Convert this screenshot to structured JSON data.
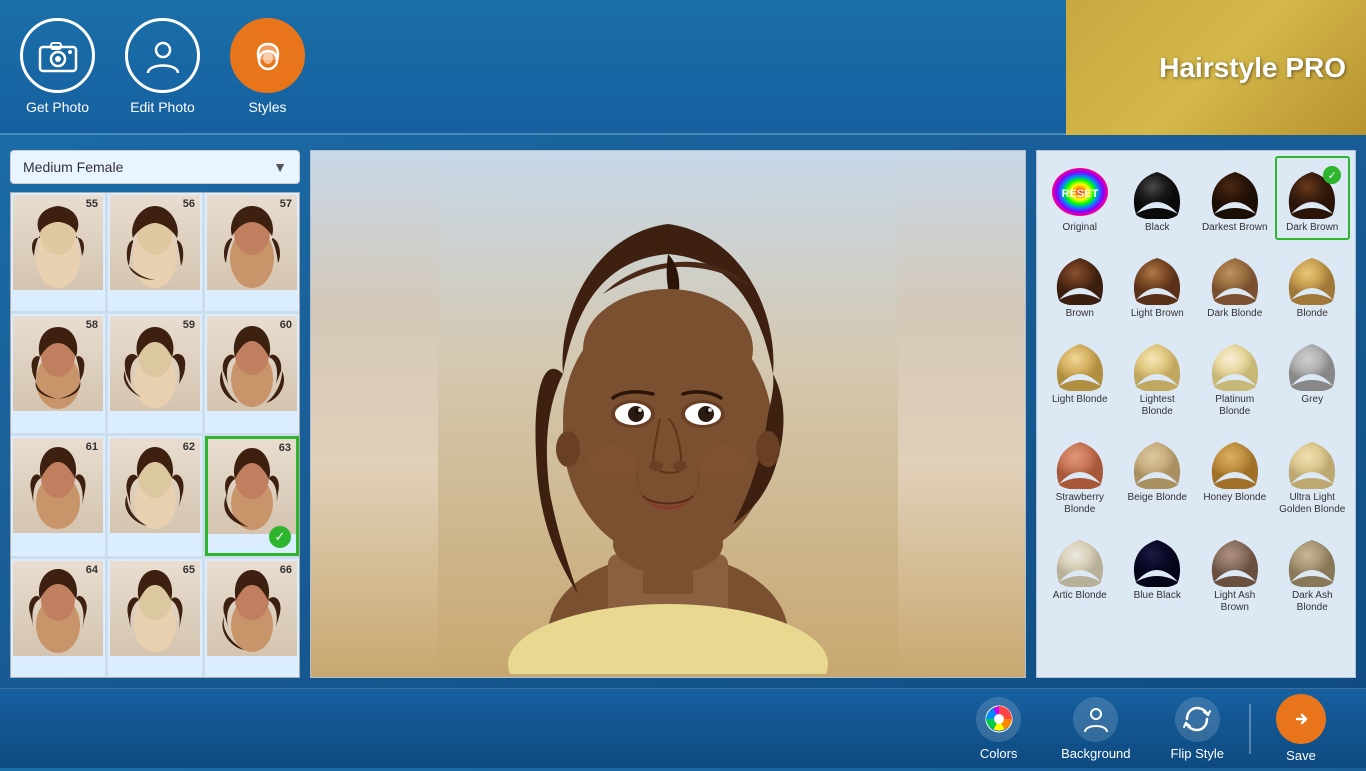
{
  "app": {
    "title": "Hairstyle PRO"
  },
  "nav": {
    "items": [
      {
        "id": "get-photo",
        "label": "Get Photo",
        "icon": "📷",
        "active": false
      },
      {
        "id": "edit-photo",
        "label": "Edit Photo",
        "icon": "👤",
        "active": false
      },
      {
        "id": "styles",
        "label": "Styles",
        "icon": "💇",
        "active": true
      }
    ]
  },
  "style_panel": {
    "dropdown_label": "Medium Female",
    "styles": [
      {
        "number": "55",
        "selected": false
      },
      {
        "number": "56",
        "selected": false
      },
      {
        "number": "57",
        "selected": false
      },
      {
        "number": "58",
        "selected": false
      },
      {
        "number": "59",
        "selected": false
      },
      {
        "number": "60",
        "selected": false
      },
      {
        "number": "61",
        "selected": false
      },
      {
        "number": "62",
        "selected": false
      },
      {
        "number": "63",
        "selected": true
      },
      {
        "number": "64",
        "selected": false
      },
      {
        "number": "65",
        "selected": false
      },
      {
        "number": "66",
        "selected": false
      }
    ]
  },
  "colors": {
    "items": [
      {
        "id": "original",
        "label": "Original",
        "type": "rainbow",
        "selected": false,
        "bg": "#ff6600"
      },
      {
        "id": "black",
        "label": "Black",
        "selected": false,
        "bg": "#1a1a1a"
      },
      {
        "id": "darkest-brown",
        "label": "Darkest Brown",
        "selected": false,
        "bg": "#2d1a0a"
      },
      {
        "id": "dark-brown",
        "label": "Dark Brown",
        "selected": true,
        "bg": "#3d2010"
      },
      {
        "id": "brown",
        "label": "Brown",
        "selected": false,
        "bg": "#5c3018"
      },
      {
        "id": "light-brown",
        "label": "Light Brown",
        "selected": false,
        "bg": "#7a4a25"
      },
      {
        "id": "dark-blonde",
        "label": "Dark Blonde",
        "selected": false,
        "bg": "#9a7040"
      },
      {
        "id": "blonde",
        "label": "Blonde",
        "selected": false,
        "bg": "#c8a050"
      },
      {
        "id": "light-blonde",
        "label": "Light Blonde",
        "selected": false,
        "bg": "#d4b060"
      },
      {
        "id": "lightest-blonde",
        "label": "Lightest Blonde",
        "selected": false,
        "bg": "#e0c880"
      },
      {
        "id": "platinum-blonde",
        "label": "Platinum Blonde",
        "selected": false,
        "bg": "#e8d8a0"
      },
      {
        "id": "grey",
        "label": "Grey",
        "selected": false,
        "bg": "#b0b0b0"
      },
      {
        "id": "strawberry-blonde",
        "label": "Strawberry Blonde",
        "selected": false,
        "bg": "#c87858"
      },
      {
        "id": "beige-blonde",
        "label": "Beige Blonde",
        "selected": false,
        "bg": "#c8b080"
      },
      {
        "id": "honey-blonde",
        "label": "Honey Blonde",
        "selected": false,
        "bg": "#c09040"
      },
      {
        "id": "ultra-light-golden-blonde",
        "label": "Ultra Light Golden Blonde",
        "selected": false,
        "bg": "#dcc890"
      },
      {
        "id": "artic-blonde",
        "label": "Artic Blonde",
        "selected": false,
        "bg": "#d8d0b8"
      },
      {
        "id": "blue-black",
        "label": "Blue Black",
        "selected": false,
        "bg": "#0a0a2a"
      },
      {
        "id": "light-ash-brown",
        "label": "Light Ash Brown",
        "selected": false,
        "bg": "#8a7060"
      },
      {
        "id": "dark-ash-blonde",
        "label": "Dark Ash Blonde",
        "selected": false,
        "bg": "#a89878"
      }
    ]
  },
  "bottom_bar": {
    "actions": [
      {
        "id": "colors",
        "label": "Colors",
        "icon": "🎨"
      },
      {
        "id": "background",
        "label": "Background",
        "icon": "👤"
      },
      {
        "id": "flip-style",
        "label": "Flip Style",
        "icon": "🔄"
      }
    ],
    "save_label": "Save"
  }
}
